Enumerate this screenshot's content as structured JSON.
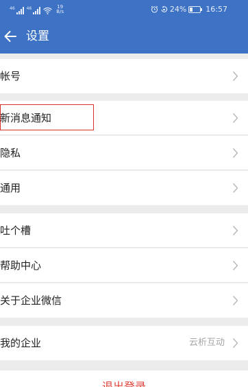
{
  "status_bar": {
    "signal_tag_1": "46",
    "signal_tag_2": "46",
    "net_speed_value": "19",
    "net_speed_unit": "B/s",
    "battery": "24%",
    "time": "16:57"
  },
  "header": {
    "title": "设置"
  },
  "groups": {
    "account": {
      "label": "帐号"
    },
    "notifications": {
      "label": "新消息通知"
    },
    "privacy": {
      "label": "隐私"
    },
    "general": {
      "label": "通用"
    },
    "feedback": {
      "label": "吐个槽"
    },
    "help": {
      "label": "帮助中心"
    },
    "about": {
      "label": "关于企业微信"
    },
    "my_company": {
      "label": "我的企业",
      "value": "云析互动"
    }
  },
  "logout": {
    "label": "退出登录"
  },
  "colors": {
    "header_bg": "#3d72c5",
    "highlight": "#d9302a",
    "logout": "#e0443c"
  }
}
